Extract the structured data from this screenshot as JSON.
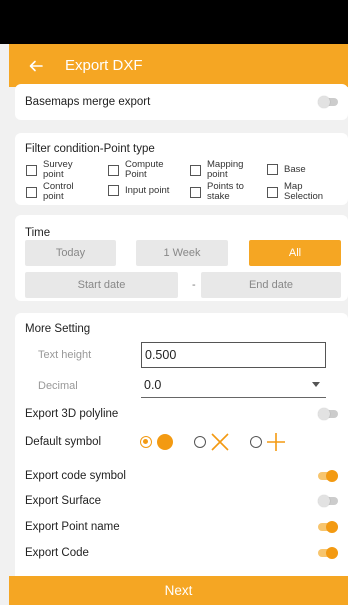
{
  "header": {
    "title": "Export DXF"
  },
  "basemaps": {
    "label": "Basemaps merge export",
    "enabled": false
  },
  "filter": {
    "title": "Filter condition-Point type",
    "items": [
      {
        "label": "Survey point",
        "checked": false
      },
      {
        "label": "Compute Point",
        "checked": false
      },
      {
        "label": "Mapping point",
        "checked": false
      },
      {
        "label": "Base",
        "checked": false
      },
      {
        "label": "Control point",
        "checked": false
      },
      {
        "label": "Input point",
        "checked": false
      },
      {
        "label": "Points to stake",
        "checked": false
      },
      {
        "label": "Map Selection",
        "checked": false
      }
    ]
  },
  "time": {
    "title": "Time",
    "options": [
      "Today",
      "1 Week",
      "All"
    ],
    "selected": "All",
    "start_placeholder": "Start date",
    "separator": "-",
    "end_placeholder": "End date"
  },
  "settings": {
    "title": "More Setting",
    "text_height_label": "Text height",
    "text_height_value": "0.500",
    "decimal_label": "Decimal",
    "decimal_value": "0.0",
    "toggles": [
      {
        "label": "Export 3D polyline",
        "enabled": false
      },
      {
        "label": "Default symbol"
      },
      {
        "label": "Export code symbol",
        "enabled": true
      },
      {
        "label": "Export Surface",
        "enabled": false
      },
      {
        "label": "Export Point name",
        "enabled": true
      },
      {
        "label": "Export Code",
        "enabled": true
      }
    ],
    "symbols": [
      "circle-dot",
      "x-cross",
      "plus"
    ],
    "selected_symbol": "circle-dot"
  },
  "footer": {
    "next_label": "Next"
  },
  "colors": {
    "accent": "#f5a623",
    "toggle_on": "#f39a12"
  }
}
